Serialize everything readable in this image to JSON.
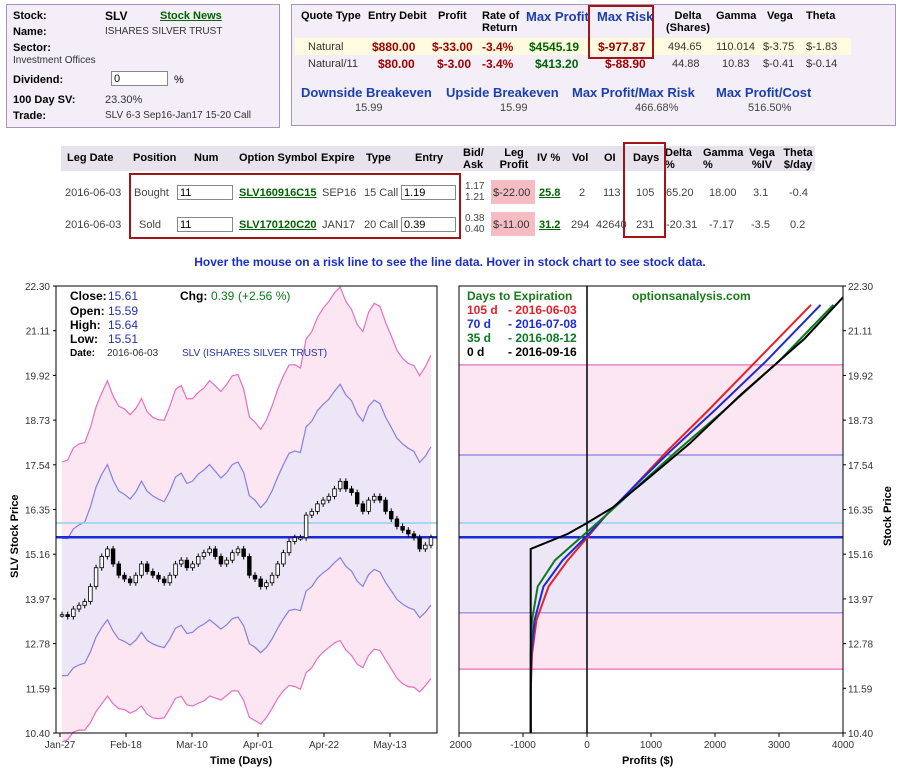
{
  "stock": {
    "stock_label": "Stock:",
    "symbol": "SLV",
    "news_link": "Stock News",
    "name_label": "Name:",
    "name": "ISHARES SILVER TRUST",
    "sector_label": "Sector:",
    "sector": "Investment Offices",
    "dividend_label": "Dividend:",
    "dividend": "0",
    "dividend_unit": "%",
    "sv_label": "100 Day SV:",
    "sv": "23.30%",
    "trade_label": "Trade:",
    "trade": "SLV 6-3 Sep16-Jan17 15-20 Call"
  },
  "quote": {
    "headers": [
      "Quote Type",
      "Entry Debit",
      "Profit",
      "Rate of Return",
      "Max Profit",
      "Max Risk",
      "Delta (Shares)",
      "Gamma",
      "Vega",
      "Theta"
    ],
    "rows": [
      [
        "Natural",
        "$880.00",
        "$-33.00",
        "-3.4%",
        "$4545.19",
        "$-977.87",
        "494.65",
        "110.014",
        "$-3.75",
        "$-1.83"
      ],
      [
        "Natural/11",
        "$80.00",
        "$-3.00",
        "-3.4%",
        "$413.20",
        "$-88.90",
        "44.88",
        "10.83",
        "$-0.41",
        "$-0.14"
      ]
    ],
    "stats": [
      {
        "label": "Downside Breakeven",
        "value": "15.99"
      },
      {
        "label": "Upside Breakeven",
        "value": "15.99"
      },
      {
        "label": "Max Profit/Max Risk",
        "value": "466.68%"
      },
      {
        "label": "Max Profit/Cost",
        "value": "516.50%"
      }
    ]
  },
  "legs": {
    "headers": [
      "Leg Date",
      "Position",
      "Num",
      "Option Symbol",
      "Expire",
      "Type",
      "Entry",
      "Bid/ Ask",
      "Leg Profit",
      "IV %",
      "Vol",
      "OI",
      "Days",
      "Delta %",
      "Gamma %",
      "Vega %IV",
      "Theta $/day"
    ],
    "rows": [
      {
        "date": "2016-06-03",
        "position": "Bought",
        "num": "11",
        "symbol": "SLV160916C15",
        "expire": "SEP16",
        "type": "15 Call",
        "entry": "1.19",
        "bid": "1.17",
        "ask": "1.21",
        "profit": "$-22.00",
        "iv": "25.8",
        "vol": "2",
        "oi": "113",
        "days": "105",
        "delta": "65.20",
        "gamma": "18.00",
        "vega": "3.1",
        "theta": "-0.4"
      },
      {
        "date": "2016-06-03",
        "position": "Sold",
        "num": "11",
        "symbol": "SLV170120C20",
        "expire": "JAN17",
        "type": "20 Call",
        "entry": "0.39",
        "bid": "0.38",
        "ask": "0.40",
        "profit": "$-11.00",
        "iv": "31.2",
        "vol": "294",
        "oi": "42640",
        "days": "231",
        "delta": "-20.31",
        "gamma": "-7.17",
        "vega": "-3.5",
        "theta": "0.2"
      }
    ]
  },
  "hover_text": "Hover the mouse on a risk line to see the line data. Hover in stock chart to see stock data.",
  "stock_chart_info": {
    "close_label": "Close:",
    "close": "15.61",
    "chg_label": "Chg:",
    "chg": "0.39",
    "chg_pct": "(+2.56 %)",
    "open_label": "Open:",
    "open": "15.59",
    "high_label": "High:",
    "high": "15.64",
    "low_label": "Low:",
    "low": "15.51",
    "date_label": "Date:",
    "date": "2016-06-03",
    "title": "SLV (ISHARES SILVER TRUST)"
  },
  "legend": {
    "title": "Days to Expiration",
    "site": "optionsanalysis.com",
    "items": [
      {
        "days": "105 d",
        "date": "- 2016-06-03",
        "color": "#e8202a"
      },
      {
        "days": "70 d",
        "date": "- 2016-07-08",
        "color": "#1a2bd6"
      },
      {
        "days": "35 d",
        "date": "- 2016-08-12",
        "color": "#0b7a22"
      },
      {
        "days": "0 d",
        "date": "- 2016-09-16",
        "color": "#000000"
      }
    ]
  },
  "chart_data": [
    {
      "type": "line",
      "title": "SLV (ISHARES SILVER TRUST)",
      "xlabel": "Time (Days)",
      "ylabel": "SLV Stock Price",
      "x_ticks": [
        "Jan-27",
        "Feb-18",
        "Mar-10",
        "Apr-01",
        "Apr-22",
        "May-13"
      ],
      "y_ticks": [
        "22.30",
        "21.11",
        "19.92",
        "18.73",
        "17.54",
        "16.35",
        "15.16",
        "13.97",
        "12.78",
        "11.59",
        "10.40"
      ],
      "ylim": [
        10.4,
        22.3
      ],
      "series": [
        {
          "values": [
            13.55,
            13.5,
            13.7,
            13.8,
            13.9,
            14.3,
            14.8,
            15.1,
            15.3,
            14.9,
            14.6,
            14.5,
            14.4,
            14.6,
            14.9,
            14.7,
            14.6,
            14.5,
            14.4,
            14.6,
            14.9,
            15.0,
            14.8,
            14.9,
            15.1,
            15.2,
            15.3,
            15.1,
            14.9,
            15.0,
            15.2,
            15.3,
            15.1,
            14.6,
            14.5,
            14.3,
            14.4,
            14.6,
            14.9,
            15.2,
            15.5,
            15.6,
            15.6,
            16.2,
            16.3,
            16.5,
            16.6,
            16.7,
            16.9,
            17.1,
            16.9,
            16.8,
            16.5,
            16.3,
            16.6,
            16.7,
            16.6,
            16.3,
            16.1,
            15.9,
            15.8,
            15.7,
            15.6,
            15.3,
            15.4,
            15.6
          ]
        }
      ],
      "reference_lines": [
        15.61,
        15.99
      ]
    },
    {
      "type": "line",
      "xlabel": "Profits ($)",
      "ylabel": "Stock Price",
      "xlim": [
        -2000,
        4000
      ],
      "ylim": [
        10.4,
        22.3
      ],
      "x_ticks": [
        "-2000",
        "-1000",
        "0",
        "1000",
        "2000",
        "3000",
        "4000"
      ],
      "series": [
        {
          "name": "105 d",
          "profit": [
            -880,
            -880,
            -860,
            -790,
            -600,
            -300,
            0,
            300,
            700,
            1250,
            1900,
            2700,
            3500
          ],
          "price": [
            10.4,
            11.5,
            12.5,
            13.4,
            14.3,
            15.0,
            15.6,
            16.2,
            16.9,
            17.9,
            19.0,
            20.4,
            21.8
          ]
        },
        {
          "name": "70 d",
          "profit": [
            -880,
            -880,
            -870,
            -820,
            -680,
            -380,
            0,
            300,
            700,
            1300,
            2000,
            2800,
            3650
          ],
          "price": [
            10.4,
            11.5,
            12.5,
            13.4,
            14.3,
            15.0,
            15.65,
            16.2,
            16.9,
            17.9,
            19.0,
            20.3,
            21.8
          ]
        },
        {
          "name": "35 d",
          "profit": [
            -880,
            -880,
            -880,
            -860,
            -770,
            -500,
            0,
            300,
            750,
            1400,
            2150,
            3000,
            3850
          ],
          "price": [
            10.4,
            11.5,
            12.5,
            13.4,
            14.3,
            15.0,
            15.75,
            16.2,
            16.9,
            17.9,
            19.0,
            20.3,
            21.8
          ]
        },
        {
          "name": "0 d",
          "profit": [
            -880,
            -880,
            -880,
            -880,
            -880,
            -880,
            -300,
            0,
            400,
            900,
            1600,
            2400,
            3400,
            4000
          ],
          "price": [
            10.4,
            11.5,
            12.5,
            13.4,
            14.3,
            15.3,
            15.7,
            15.99,
            16.4,
            17.1,
            18.1,
            19.4,
            20.9,
            22.0
          ]
        }
      ]
    }
  ]
}
